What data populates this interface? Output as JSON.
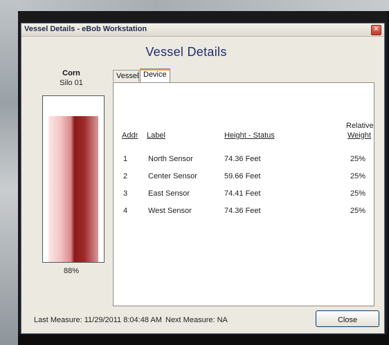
{
  "window": {
    "title": "Vessel Details - eBob Workstation",
    "close_glyph": "✕"
  },
  "heading": "Vessel Details",
  "silo": {
    "name": "Corn",
    "id": "Silo 01",
    "percent_label": "88%",
    "fill_level": 0.88,
    "fill_color": "#8b1a1a"
  },
  "tabs": [
    {
      "label": "Vessel",
      "active": false
    },
    {
      "label": "Device",
      "active": true
    }
  ],
  "table": {
    "headers": {
      "addr": "Addr",
      "label": "Label",
      "height_status": "Height - Status",
      "relative": "Relative",
      "weight": "Weight"
    },
    "rows": [
      {
        "addr": "1",
        "label": "North Sensor",
        "height": "74.36  Feet",
        "weight": "25%"
      },
      {
        "addr": "2",
        "label": "Center Sensor",
        "height": "59.66  Feet",
        "weight": "25%"
      },
      {
        "addr": "3",
        "label": "East Sensor",
        "height": "74.41  Feet",
        "weight": "25%"
      },
      {
        "addr": "4",
        "label": "West Sensor",
        "height": "74.36  Feet",
        "weight": "25%"
      }
    ]
  },
  "footer": {
    "last_measure": "Last Measure: 11/29/2011 8:04:48 AM",
    "next_measure": "Next Measure: NA",
    "close_label": "Close"
  }
}
